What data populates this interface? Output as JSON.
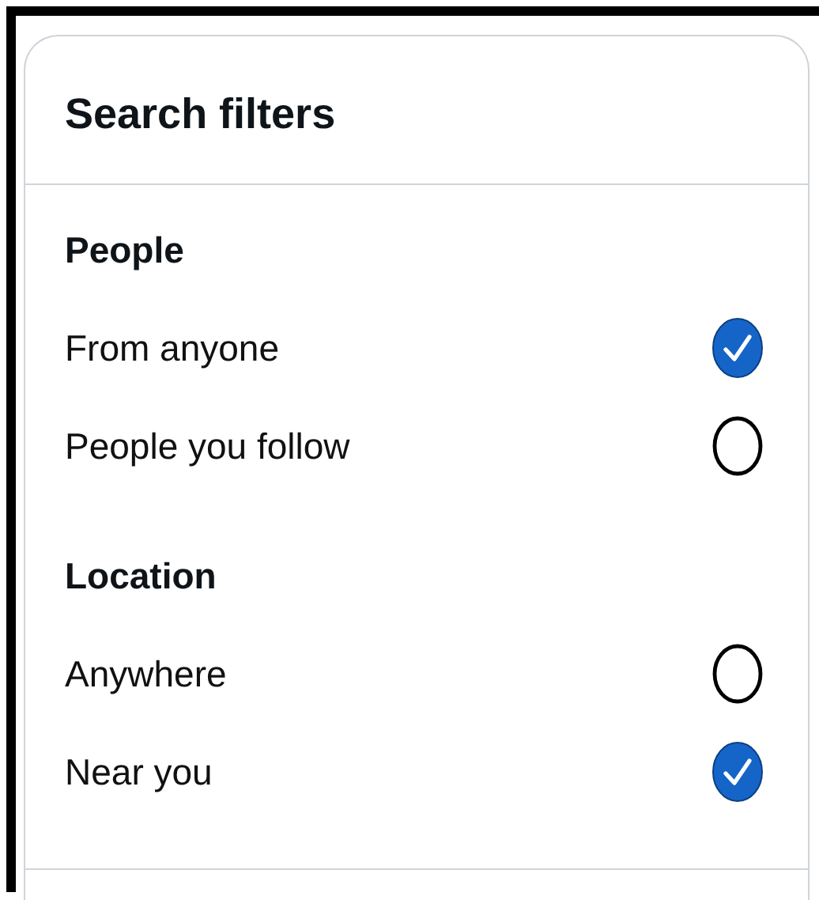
{
  "title": "Search filters",
  "sections": [
    {
      "heading": "People",
      "options": [
        {
          "label": "From anyone",
          "selected": true
        },
        {
          "label": "People you follow",
          "selected": false
        }
      ]
    },
    {
      "heading": "Location",
      "options": [
        {
          "label": "Anywhere",
          "selected": false
        },
        {
          "label": "Near you",
          "selected": true
        }
      ]
    }
  ]
}
